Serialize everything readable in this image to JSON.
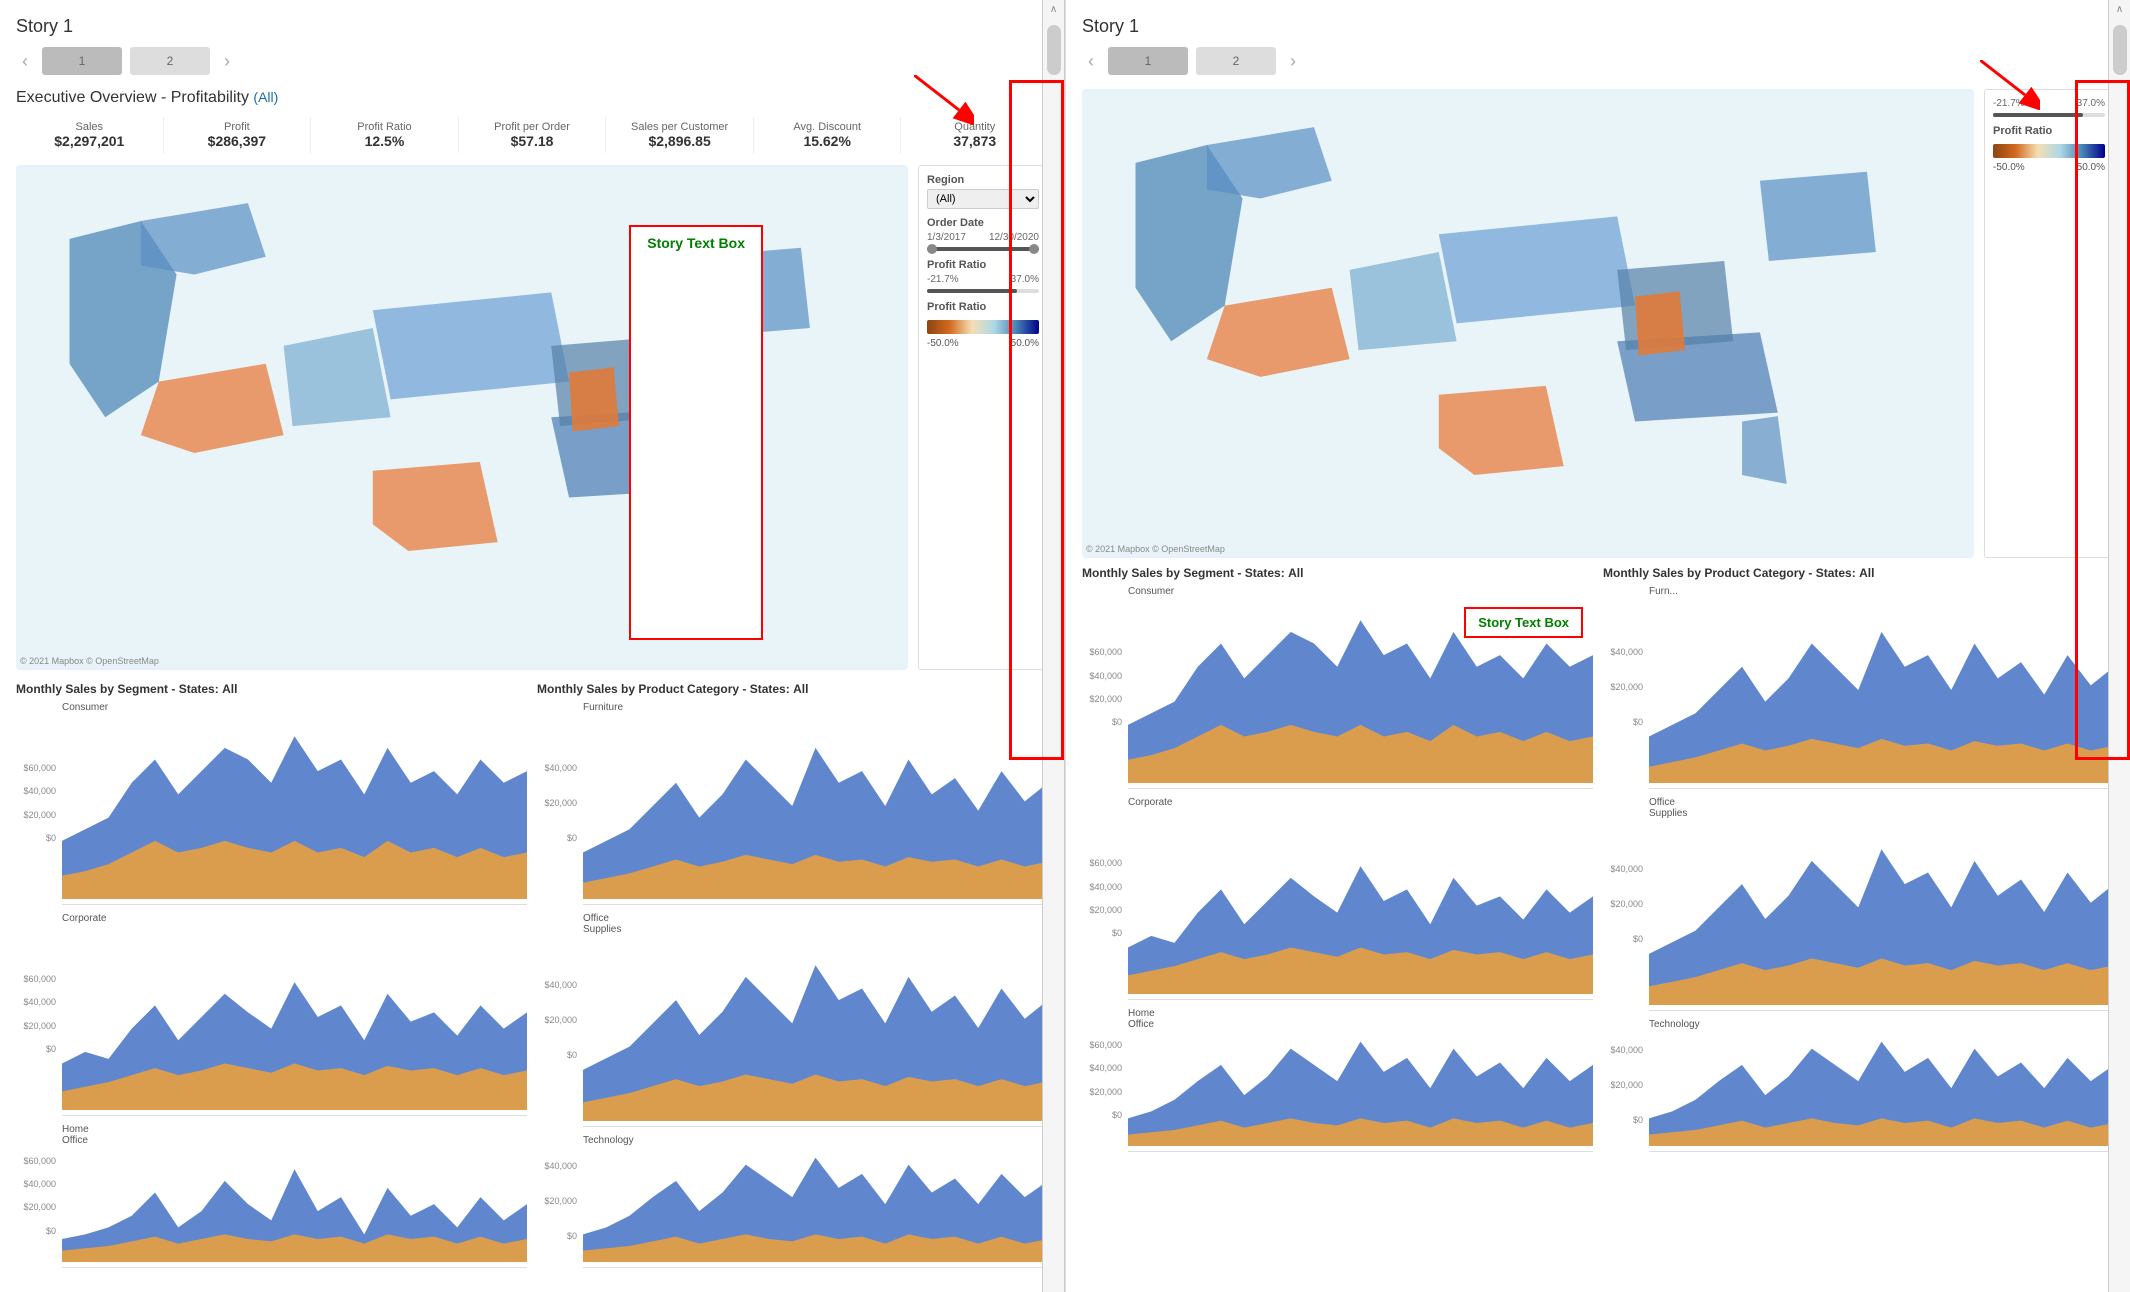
{
  "left_panel": {
    "story_title": "Story 1",
    "nav": {
      "prev_arrow": "‹",
      "next_arrow": "›",
      "dots": [
        "1",
        "2"
      ]
    },
    "exec_title": "Executive Overview - Profitability",
    "all_badge": "(All)",
    "kpis": [
      {
        "label": "Sales",
        "value": "$2,297,201"
      },
      {
        "label": "Profit",
        "value": "$286,397"
      },
      {
        "label": "Profit Ratio",
        "value": "12.5%"
      },
      {
        "label": "Profit per Order",
        "value": "$57.18"
      },
      {
        "label": "Sales per Customer",
        "value": "$2,896.85"
      },
      {
        "label": "Avg. Discount",
        "value": "15.62%"
      },
      {
        "label": "Quantity",
        "value": "37,873"
      }
    ],
    "filters": {
      "region_label": "Region",
      "region_value": "(All)",
      "order_date_label": "Order Date",
      "order_date_from": "1/3/2017",
      "order_date_to": "12/30/2020",
      "profit_ratio_label": "Profit Ratio",
      "profit_ratio_min": "-21.7%",
      "profit_ratio_max": "37.0%",
      "color_legend_label": "Profit Ratio",
      "color_min": "-50.0%",
      "color_max": "50.0%"
    },
    "story_text_box_label": "Story Text Box",
    "map_copyright": "© 2021 Mapbox © OpenStreetMap",
    "charts": {
      "segment_title": "Monthly Sales by Segment - States:",
      "segment_bold": "All",
      "product_title": "Monthly Sales by Product Category - States:",
      "product_bold": "All",
      "segments": [
        {
          "label": "Consumer",
          "y_labels": [
            "$60,000",
            "$40,000",
            "$20,000",
            "$0"
          ]
        },
        {
          "label": "Corporate",
          "y_labels": [
            "$60,000",
            "$40,000",
            "$20,000",
            "$0"
          ]
        },
        {
          "label": "Home Office",
          "y_labels": [
            "$60,000",
            "$40,000",
            "$20,000",
            "$0"
          ]
        }
      ],
      "products": [
        {
          "label": "Furniture",
          "y_labels": [
            "$40,000",
            "$20,000",
            "$0"
          ]
        },
        {
          "label": "Office Supplies",
          "y_labels": [
            "$40,000",
            "$20,000",
            "$0"
          ]
        },
        {
          "label": "Technology",
          "y_labels": [
            "$40,000",
            "$20,000",
            "$0"
          ]
        }
      ]
    }
  },
  "right_panel": {
    "story_title": "Story 1",
    "nav": {
      "prev_arrow": "‹",
      "next_arrow": "›",
      "dots": [
        "1",
        "2"
      ]
    },
    "filters": {
      "profit_ratio_label": "Profit Ratio",
      "profit_ratio_min": "-21.7%",
      "profit_ratio_max": "37.0%",
      "color_legend_label": "Profit Ratio",
      "color_min": "-50.0%",
      "color_max": "50.0%"
    },
    "map_copyright": "© 2021 Mapbox © OpenStreetMap",
    "story_text_box_label": "Story Text Box",
    "charts": {
      "segment_title": "Monthly Sales by Segment - States:",
      "segment_bold": "All",
      "product_title": "Monthly Sales by Product Category - States:",
      "product_bold": "All",
      "segments": [
        {
          "label": "Consumer"
        },
        {
          "label": "Corporate"
        },
        {
          "label": "Home Office"
        }
      ],
      "products": [
        {
          "label": "Furn..."
        },
        {
          "label": "Office\nSupplies"
        },
        {
          "label": "Technology"
        }
      ]
    }
  },
  "red_arrow": "↓",
  "scroll_up": "∧",
  "scroll_down": "∨"
}
